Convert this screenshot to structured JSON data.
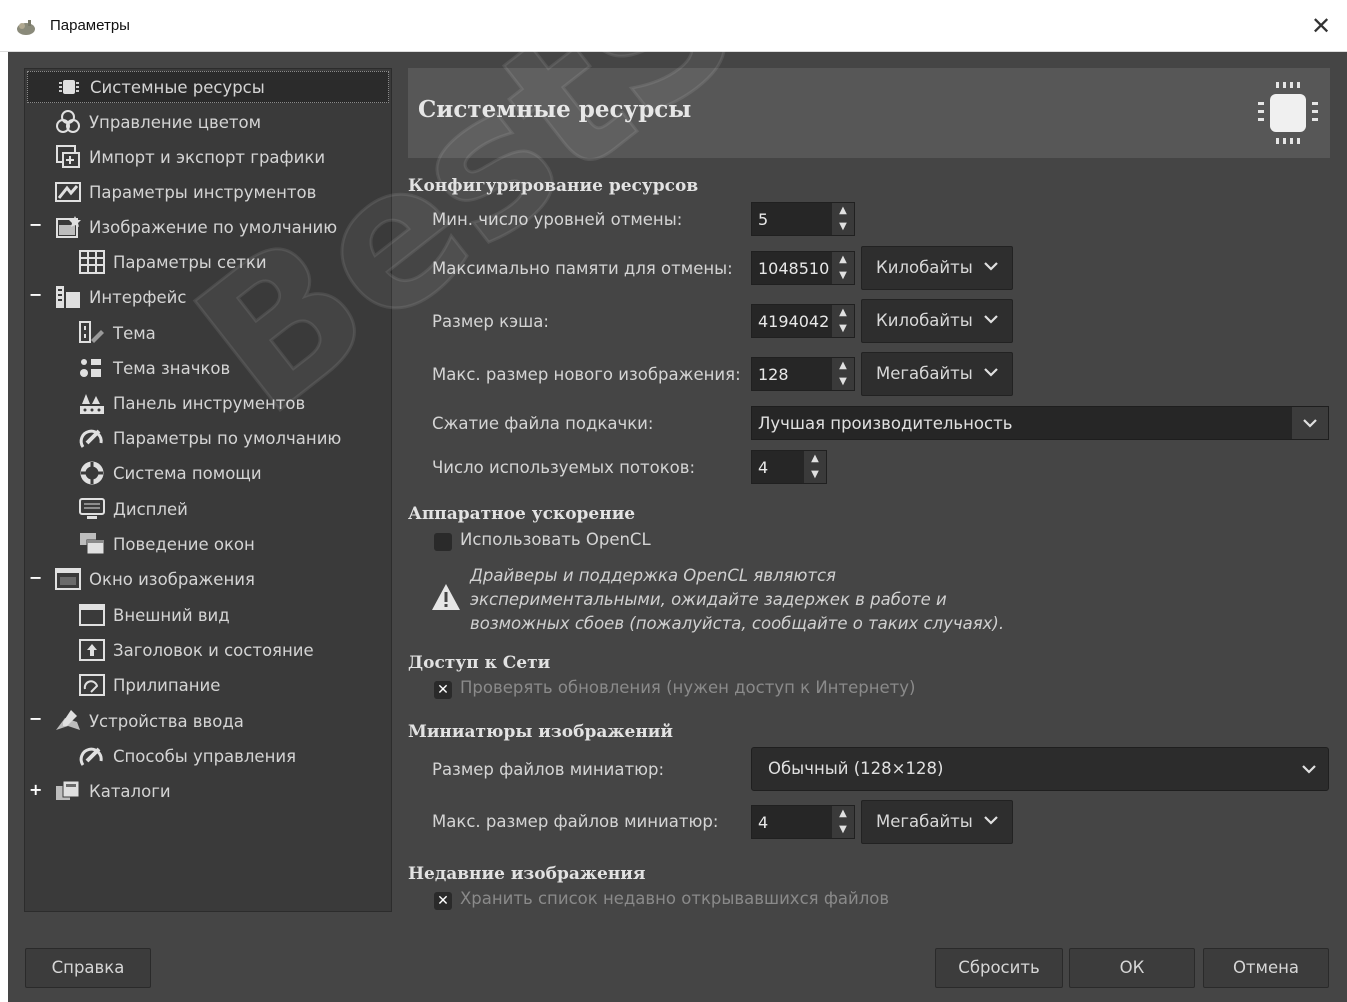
{
  "window": {
    "title": "Параметры",
    "close_glyph": "✕"
  },
  "sidebar": {
    "items": [
      {
        "label": "Системные ресурсы",
        "icon": "chip-icon",
        "selected": true
      },
      {
        "label": "Управление цветом",
        "icon": "color-circles-icon"
      },
      {
        "label": "Импорт и экспорт графики",
        "icon": "import-export-icon"
      },
      {
        "label": "Параметры инструментов",
        "icon": "tool-options-icon"
      },
      {
        "label": "Изображение по умолчанию",
        "icon": "default-image-icon",
        "expander": "−"
      },
      {
        "label": "Параметры сетки",
        "icon": "grid-icon"
      },
      {
        "label": "Интерфейс",
        "icon": "interface-icon",
        "expander": "−"
      },
      {
        "label": "Тема",
        "icon": "theme-icon"
      },
      {
        "label": "Тема значков",
        "icon": "icon-theme-icon"
      },
      {
        "label": "Панель инструментов",
        "icon": "toolbox-icon"
      },
      {
        "label": "Параметры по умолчанию",
        "icon": "defaults-icon"
      },
      {
        "label": "Система помощи",
        "icon": "help-ring-icon"
      },
      {
        "label": "Дисплей",
        "icon": "display-icon"
      },
      {
        "label": "Поведение окон",
        "icon": "windows-icon"
      },
      {
        "label": "Окно изображения",
        "icon": "image-window-icon",
        "expander": "−"
      },
      {
        "label": "Внешний вид",
        "icon": "appearance-icon"
      },
      {
        "label": "Заголовок и состояние",
        "icon": "title-status-icon"
      },
      {
        "label": "Прилипание",
        "icon": "snapping-icon"
      },
      {
        "label": "Устройства ввода",
        "icon": "input-devices-icon",
        "expander": "−"
      },
      {
        "label": "Способы управления",
        "icon": "controllers-icon"
      },
      {
        "label": "Каталоги",
        "icon": "folders-icon",
        "expander": "+"
      }
    ]
  },
  "main": {
    "header_title": "Системные ресурсы",
    "sections": {
      "resources": "Конфигурирование ресурсов",
      "hardware": "Аппаратное ускорение",
      "network": "Доступ к Сети",
      "thumbnails": "Миниатюры изображений",
      "recent": "Недавние изображения"
    },
    "fields": {
      "undo_levels_label": "Мин. число уровней отмены:",
      "undo_levels_value": "5",
      "undo_memory_label": "Максимально памяти для отмены:",
      "undo_memory_value": "1048510",
      "undo_memory_unit": "Килобайты",
      "cache_label": "Размер кэша:",
      "cache_value": "4194042",
      "cache_unit": "Килобайты",
      "max_new_label": "Макс. размер нового изображения:",
      "max_new_value": "128",
      "max_new_unit": "Мегабайты",
      "swap_label": "Сжатие файла подкачки:",
      "swap_value": "Лучшая производительность",
      "threads_label": "Число используемых потоков:",
      "threads_value": "4",
      "opencl_label": "Использовать OpenCL",
      "opencl_checked": false,
      "opencl_warning_1": "Драйверы и поддержка OpenCL являются",
      "opencl_warning_2": "экспериментальными, ожидайте задержек в работе и",
      "opencl_warning_3": "возможных сбоев (пожалуйста, сообщайте о таких случаях).",
      "updates_label": "Проверять обновления (нужен доступ к Интернету)",
      "updates_checked": true,
      "thumb_size_label": "Размер файлов миниатюр:",
      "thumb_size_value": "Обычный (128×128)",
      "thumb_max_label": "Макс. размер файлов миниатюр:",
      "thumb_max_value": "4",
      "thumb_max_unit": "Мегабайты",
      "recent_label": "Хранить список недавно открывавшихся файлов",
      "recent_checked": true
    }
  },
  "buttons": {
    "help": "Справка",
    "reset": "Сбросить",
    "ok": "ОК",
    "cancel": "Отмена"
  },
  "watermark": "BestSoftClub",
  "colors": {
    "background": "#454545",
    "sidebar": "#3a3a3a",
    "header": "#575757",
    "input": "#262626"
  }
}
